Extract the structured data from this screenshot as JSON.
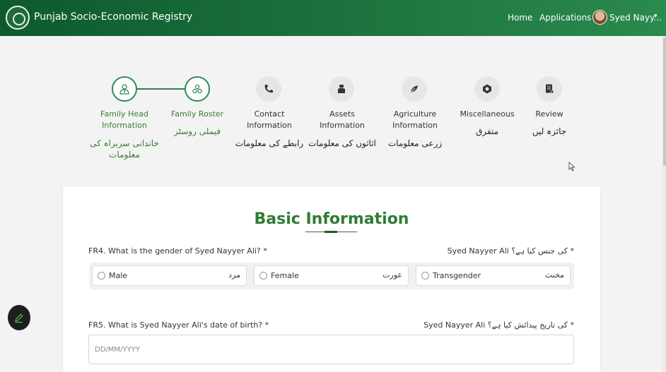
{
  "header": {
    "app_title": "Punjab Socio-Economic Registry",
    "nav": {
      "home": "Home",
      "applications": "Applications"
    },
    "user_name": "Syed Nayy...",
    "caret": "▾"
  },
  "steps": [
    {
      "label_line1": "Family Head",
      "label_line2": "Information",
      "urdu_line1": "خاندانی سربراہ کی",
      "urdu_line2": "معلومات",
      "state": "done",
      "icon": "user-tie-icon"
    },
    {
      "label_line1": "Family Roster",
      "label_line2": "",
      "urdu_line1": "فیملی روسٹر",
      "urdu_line2": "",
      "state": "current",
      "icon": "family-group-icon"
    },
    {
      "label_line1": "Contact",
      "label_line2": "Information",
      "urdu_line1": "رابطے کی معلومات",
      "urdu_line2": "",
      "state": "pending",
      "icon": "phone-icon"
    },
    {
      "label_line1": "Assets",
      "label_line2": "Information",
      "urdu_line1": "اثاثوں کی معلومات",
      "urdu_line2": "",
      "state": "pending",
      "icon": "assets-icon"
    },
    {
      "label_line1": "Agriculture",
      "label_line2": "Information",
      "urdu_line1": "زرعی معلومات",
      "urdu_line2": "",
      "state": "pending",
      "icon": "agriculture-icon"
    },
    {
      "label_line1": "Miscellaneous",
      "label_line2": "",
      "urdu_line1": "متفرق",
      "urdu_line2": "",
      "state": "pending",
      "icon": "miscellaneous-icon"
    },
    {
      "label_line1": "Review",
      "label_line2": "",
      "urdu_line1": "جائزہ لیں",
      "urdu_line2": "",
      "state": "pending",
      "icon": "review-icon"
    }
  ],
  "form": {
    "title": "Basic Information",
    "q4": {
      "label": "FR4. What is the gender of Syed Nayyer Ali? *",
      "urdu": "Syed Nayyer Ali کی جنس کیا ہے؟ *",
      "options": [
        {
          "label": "Male",
          "urdu": "مرد"
        },
        {
          "label": "Female",
          "urdu": "عورت"
        },
        {
          "label": "Transgender",
          "urdu": "مخنث"
        }
      ]
    },
    "q5": {
      "label": "FR5. What is Syed Nayyer Ali's date of birth? *",
      "urdu": "Syed Nayyer Ali کی تاریخ پیدائش کیا ہے؟ *",
      "placeholder": "DD/MM/YYYY",
      "value": ""
    }
  },
  "colors": {
    "header_start": "#0d5a2e",
    "header_end": "#2b8a4e",
    "accent": "#2e7d32",
    "step_done_border": "#2e8b57"
  },
  "icons": {
    "fab": "pencil-icon",
    "logo": "punjab-logo",
    "cursor": "mouse-pointer-icon"
  }
}
